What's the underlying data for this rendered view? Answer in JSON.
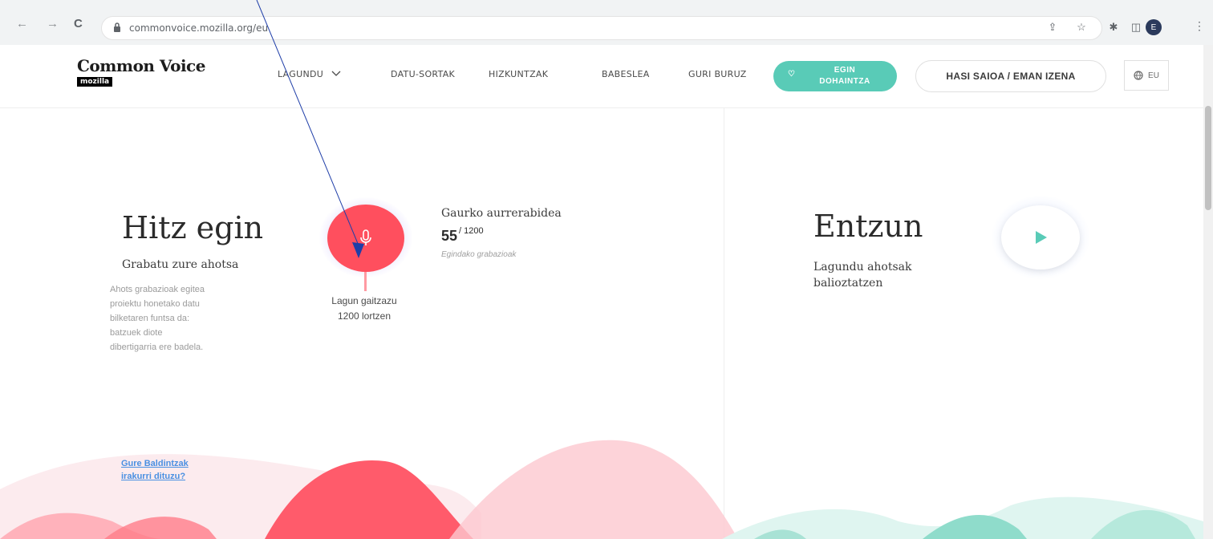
{
  "browser": {
    "back_icon": "←",
    "forward_icon": "→",
    "reload_icon": "C",
    "url": "commonvoice.mozilla.org/eu",
    "avatar_initial": "E",
    "menu_icon": "⋮"
  },
  "header": {
    "logo_title": "Common Voice",
    "logo_badge": "mozilla",
    "nav": {
      "lagundu": "LAGUNDU",
      "datu_sortak": "DATU-SORTAK",
      "hizkuntzak": "HIZKUNTZAK",
      "babeslea": "BABESLEA",
      "guri_buruz": "GURI BURUZ"
    },
    "donate_line1": "EGIN",
    "donate_line2": "DOHAINTZA",
    "login": "HASI SAIOA / EMAN IZENA",
    "language": "EU"
  },
  "speak": {
    "title": "Hitz egin",
    "subtitle": "Grabatu zure ahotsa",
    "description": "Ahots grabazioak egitea proiektu honetako datu bilketaren funtsa da: batzuek diote dibertigarria ere badela.",
    "terms_link": "Gure Baldintzak irakurri dituzu?",
    "help_text": "Lagun gaitzazu 1200 lortzen"
  },
  "progress": {
    "title": "Gaurko aurrerabidea",
    "count": "55",
    "goal": "/ 1200",
    "caption": "Egindako grabazioak"
  },
  "listen": {
    "title": "Entzun",
    "subtitle": "Lagundu ahotsak balioztatzen"
  },
  "colors": {
    "accent_red": "#ff4f5e",
    "accent_teal": "#59cbb7",
    "play_green": "#59cbb7",
    "annotation_arrow": "#1f3ea8"
  }
}
